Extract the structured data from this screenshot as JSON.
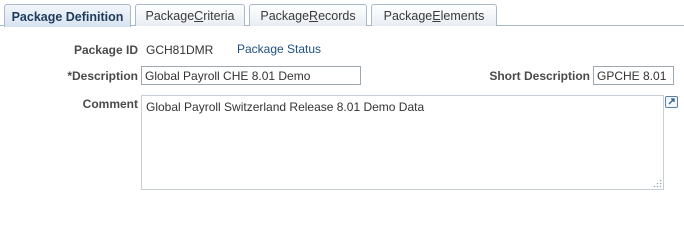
{
  "tabs": [
    {
      "label_pre": "Package Definition",
      "label_u": "",
      "label_post": ""
    },
    {
      "label_pre": "Package ",
      "label_u": "C",
      "label_post": "riteria"
    },
    {
      "label_pre": "Package ",
      "label_u": "R",
      "label_post": "ecords"
    },
    {
      "label_pre": "Package ",
      "label_u": "E",
      "label_post": "lements"
    }
  ],
  "form": {
    "package_id_label": "Package ID",
    "package_id_value": "GCH81DMR",
    "package_status_link": "Package Status",
    "description_label": "*Description",
    "description_value": "Global Payroll CHE 8.01 Demo",
    "short_description_label": "Short Description",
    "short_description_value": "GPCHE 8.01",
    "comment_label": "Comment",
    "comment_value": "Global Payroll Switzerland Release 8.01 Demo Data"
  },
  "icons": {
    "expand": "expand-icon",
    "resize": "resize-grip-icon"
  }
}
